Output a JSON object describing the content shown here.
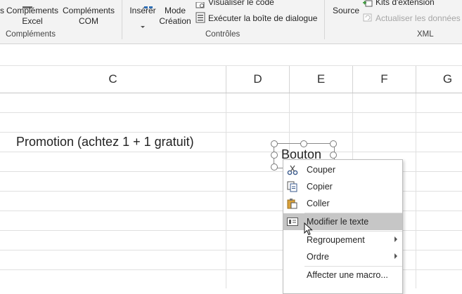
{
  "ribbon": {
    "complements": {
      "excel_addins_line1": "Compléments",
      "excel_addins_line2": "Excel",
      "com_addins_line1": "Compléments",
      "com_addins_line2": "COM",
      "group_label": "Compléments"
    },
    "controls": {
      "insert_label": "Insérer",
      "design_mode_line1": "Mode",
      "design_mode_line2": "Création",
      "view_code_label": "Visualiser le code",
      "run_dialog_label": "Exécuter la boîte de dialogue",
      "group_label": "Contrôles"
    },
    "xml": {
      "source_label": "Source",
      "expansion_packs_label": "Kits d'extension",
      "refresh_data_label": "Actualiser les données",
      "group_label": "XML"
    }
  },
  "columns": [
    "C",
    "D",
    "E",
    "F",
    "G"
  ],
  "cells": {
    "c_promo": "Promotion (achtez 1 + 1 gratuit)"
  },
  "form_button": {
    "label": "Bouton"
  },
  "context_menu": {
    "items": [
      {
        "label": "Couper",
        "icon": "scissors-icon"
      },
      {
        "label": "Copier",
        "icon": "copy-icon"
      },
      {
        "label": "Coller",
        "icon": "paste-icon"
      },
      {
        "label": "Modifier le texte",
        "icon": "edit-text-icon",
        "highlighted": true
      },
      {
        "label": "Regroupement",
        "submenu": true
      },
      {
        "label": "Ordre",
        "submenu": true
      },
      {
        "label": "Affecter une macro..."
      }
    ]
  },
  "colors": {
    "ribbon_bg": "#f3f3f3",
    "menu_highlight": "#c6c6c6"
  }
}
